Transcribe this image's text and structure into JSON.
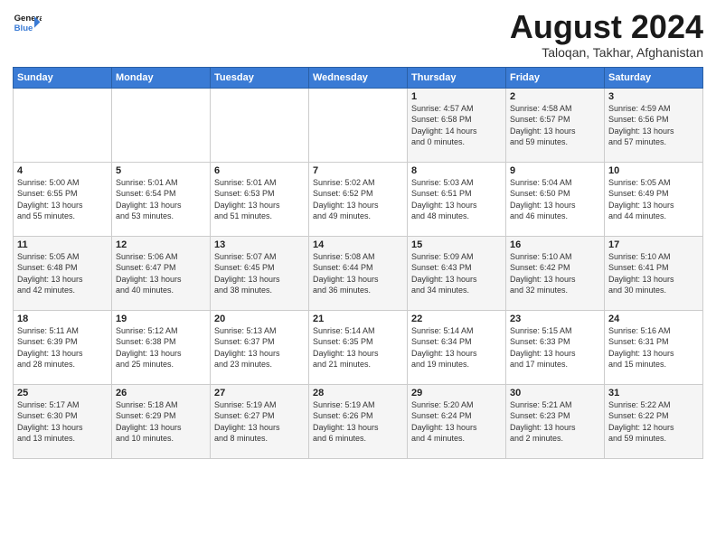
{
  "logo": {
    "line1": "General",
    "line2": "Blue"
  },
  "title": "August 2024",
  "subtitle": "Taloqan, Takhar, Afghanistan",
  "days_of_week": [
    "Sunday",
    "Monday",
    "Tuesday",
    "Wednesday",
    "Thursday",
    "Friday",
    "Saturday"
  ],
  "weeks": [
    [
      {
        "day": "",
        "info": ""
      },
      {
        "day": "",
        "info": ""
      },
      {
        "day": "",
        "info": ""
      },
      {
        "day": "",
        "info": ""
      },
      {
        "day": "1",
        "info": "Sunrise: 4:57 AM\nSunset: 6:58 PM\nDaylight: 14 hours\nand 0 minutes."
      },
      {
        "day": "2",
        "info": "Sunrise: 4:58 AM\nSunset: 6:57 PM\nDaylight: 13 hours\nand 59 minutes."
      },
      {
        "day": "3",
        "info": "Sunrise: 4:59 AM\nSunset: 6:56 PM\nDaylight: 13 hours\nand 57 minutes."
      }
    ],
    [
      {
        "day": "4",
        "info": "Sunrise: 5:00 AM\nSunset: 6:55 PM\nDaylight: 13 hours\nand 55 minutes."
      },
      {
        "day": "5",
        "info": "Sunrise: 5:01 AM\nSunset: 6:54 PM\nDaylight: 13 hours\nand 53 minutes."
      },
      {
        "day": "6",
        "info": "Sunrise: 5:01 AM\nSunset: 6:53 PM\nDaylight: 13 hours\nand 51 minutes."
      },
      {
        "day": "7",
        "info": "Sunrise: 5:02 AM\nSunset: 6:52 PM\nDaylight: 13 hours\nand 49 minutes."
      },
      {
        "day": "8",
        "info": "Sunrise: 5:03 AM\nSunset: 6:51 PM\nDaylight: 13 hours\nand 48 minutes."
      },
      {
        "day": "9",
        "info": "Sunrise: 5:04 AM\nSunset: 6:50 PM\nDaylight: 13 hours\nand 46 minutes."
      },
      {
        "day": "10",
        "info": "Sunrise: 5:05 AM\nSunset: 6:49 PM\nDaylight: 13 hours\nand 44 minutes."
      }
    ],
    [
      {
        "day": "11",
        "info": "Sunrise: 5:05 AM\nSunset: 6:48 PM\nDaylight: 13 hours\nand 42 minutes."
      },
      {
        "day": "12",
        "info": "Sunrise: 5:06 AM\nSunset: 6:47 PM\nDaylight: 13 hours\nand 40 minutes."
      },
      {
        "day": "13",
        "info": "Sunrise: 5:07 AM\nSunset: 6:45 PM\nDaylight: 13 hours\nand 38 minutes."
      },
      {
        "day": "14",
        "info": "Sunrise: 5:08 AM\nSunset: 6:44 PM\nDaylight: 13 hours\nand 36 minutes."
      },
      {
        "day": "15",
        "info": "Sunrise: 5:09 AM\nSunset: 6:43 PM\nDaylight: 13 hours\nand 34 minutes."
      },
      {
        "day": "16",
        "info": "Sunrise: 5:10 AM\nSunset: 6:42 PM\nDaylight: 13 hours\nand 32 minutes."
      },
      {
        "day": "17",
        "info": "Sunrise: 5:10 AM\nSunset: 6:41 PM\nDaylight: 13 hours\nand 30 minutes."
      }
    ],
    [
      {
        "day": "18",
        "info": "Sunrise: 5:11 AM\nSunset: 6:39 PM\nDaylight: 13 hours\nand 28 minutes."
      },
      {
        "day": "19",
        "info": "Sunrise: 5:12 AM\nSunset: 6:38 PM\nDaylight: 13 hours\nand 25 minutes."
      },
      {
        "day": "20",
        "info": "Sunrise: 5:13 AM\nSunset: 6:37 PM\nDaylight: 13 hours\nand 23 minutes."
      },
      {
        "day": "21",
        "info": "Sunrise: 5:14 AM\nSunset: 6:35 PM\nDaylight: 13 hours\nand 21 minutes."
      },
      {
        "day": "22",
        "info": "Sunrise: 5:14 AM\nSunset: 6:34 PM\nDaylight: 13 hours\nand 19 minutes."
      },
      {
        "day": "23",
        "info": "Sunrise: 5:15 AM\nSunset: 6:33 PM\nDaylight: 13 hours\nand 17 minutes."
      },
      {
        "day": "24",
        "info": "Sunrise: 5:16 AM\nSunset: 6:31 PM\nDaylight: 13 hours\nand 15 minutes."
      }
    ],
    [
      {
        "day": "25",
        "info": "Sunrise: 5:17 AM\nSunset: 6:30 PM\nDaylight: 13 hours\nand 13 minutes."
      },
      {
        "day": "26",
        "info": "Sunrise: 5:18 AM\nSunset: 6:29 PM\nDaylight: 13 hours\nand 10 minutes."
      },
      {
        "day": "27",
        "info": "Sunrise: 5:19 AM\nSunset: 6:27 PM\nDaylight: 13 hours\nand 8 minutes."
      },
      {
        "day": "28",
        "info": "Sunrise: 5:19 AM\nSunset: 6:26 PM\nDaylight: 13 hours\nand 6 minutes."
      },
      {
        "day": "29",
        "info": "Sunrise: 5:20 AM\nSunset: 6:24 PM\nDaylight: 13 hours\nand 4 minutes."
      },
      {
        "day": "30",
        "info": "Sunrise: 5:21 AM\nSunset: 6:23 PM\nDaylight: 13 hours\nand 2 minutes."
      },
      {
        "day": "31",
        "info": "Sunrise: 5:22 AM\nSunset: 6:22 PM\nDaylight: 12 hours\nand 59 minutes."
      }
    ]
  ]
}
